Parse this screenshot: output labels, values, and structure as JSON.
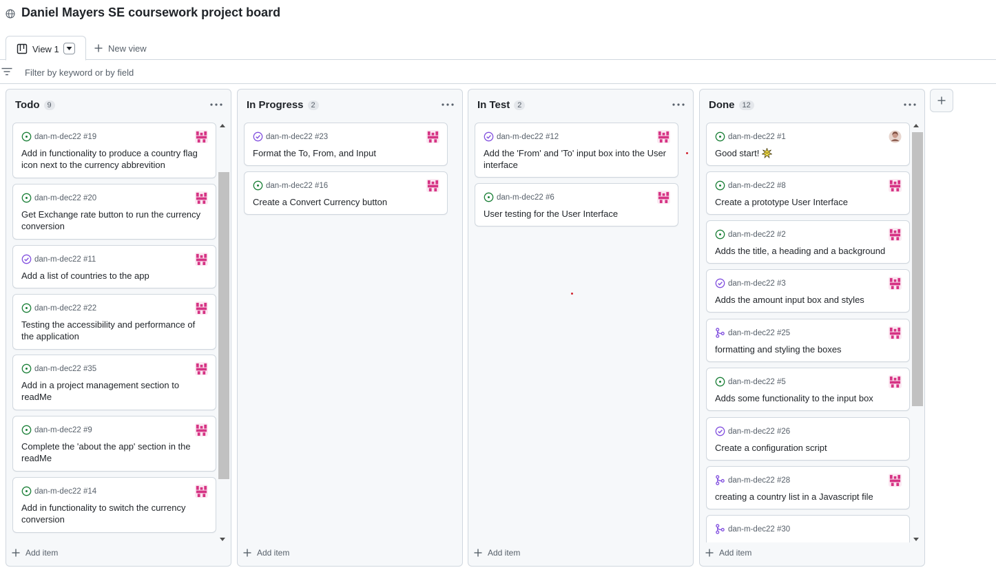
{
  "header": {
    "title": "Daniel Mayers SE coursework project board"
  },
  "tabs": {
    "active_label": "View 1",
    "new_view_label": "New view"
  },
  "filter": {
    "placeholder": "Filter by keyword or by field"
  },
  "colors": {
    "open": "#1a7f37",
    "done": "#8250df",
    "avatar": "#d63384"
  },
  "columns": [
    {
      "name": "Todo",
      "count": "9",
      "cards": [
        {
          "status": "open",
          "ref": "dan-m-dec22 #19",
          "title": "Add in functionality to produce a country flag icon next to the currency abbrevition",
          "avatar": "pink"
        },
        {
          "status": "open",
          "ref": "dan-m-dec22 #20",
          "title": "Get Exchange rate button to run the currency conversion",
          "avatar": "pink"
        },
        {
          "status": "done",
          "ref": "dan-m-dec22 #11",
          "title": "Add a list of countries to the app",
          "avatar": "pink"
        },
        {
          "status": "open",
          "ref": "dan-m-dec22 #22",
          "title": "Testing the accessibility and performance of the application",
          "avatar": "pink"
        },
        {
          "status": "open",
          "ref": "dan-m-dec22 #35",
          "title": "Add in a project management section to readMe",
          "avatar": "pink"
        },
        {
          "status": "open",
          "ref": "dan-m-dec22 #9",
          "title": "Complete the 'about the app' section in the readMe",
          "avatar": "pink"
        },
        {
          "status": "open",
          "ref": "dan-m-dec22 #14",
          "title": "Add in functionality to switch the currency conversion",
          "avatar": "pink"
        }
      ],
      "add_item": "Add item"
    },
    {
      "name": "In Progress",
      "count": "2",
      "cards": [
        {
          "status": "done",
          "ref": "dan-m-dec22 #23",
          "title": "Format the To, From, and Input",
          "avatar": "pink"
        },
        {
          "status": "open",
          "ref": "dan-m-dec22 #16",
          "title": "Create a Convert Currency button",
          "avatar": "pink"
        }
      ],
      "add_item": "Add item"
    },
    {
      "name": "In Test",
      "count": "2",
      "cards": [
        {
          "status": "done",
          "ref": "dan-m-dec22 #12",
          "title": "Add the 'From' and 'To' input box into the User interface",
          "avatar": "pink"
        },
        {
          "status": "open",
          "ref": "dan-m-dec22 #6",
          "title": "User testing for the User Interface",
          "avatar": "pink"
        }
      ],
      "add_item": "Add item"
    },
    {
      "name": "Done",
      "count": "12",
      "cards": [
        {
          "status": "open",
          "ref": "dan-m-dec22 #1",
          "title": "Good start!",
          "avatar": "photo",
          "emoji": "burst-icon"
        },
        {
          "status": "open",
          "ref": "dan-m-dec22 #8",
          "title": "Create a prototype User Interface",
          "avatar": "pink"
        },
        {
          "status": "open",
          "ref": "dan-m-dec22 #2",
          "title": "Adds the title, a heading and a background",
          "avatar": "pink"
        },
        {
          "status": "done",
          "ref": "dan-m-dec22 #3",
          "title": "Adds the amount input box and styles",
          "avatar": "pink"
        },
        {
          "status": "pr",
          "ref": "dan-m-dec22 #25",
          "title": "formatting and styling the boxes",
          "avatar": "pink"
        },
        {
          "status": "open",
          "ref": "dan-m-dec22 #5",
          "title": "Adds some functionality to the input box",
          "avatar": "pink"
        },
        {
          "status": "done",
          "ref": "dan-m-dec22 #26",
          "title": "Create a configuration script",
          "avatar": "none"
        },
        {
          "status": "pr",
          "ref": "dan-m-dec22 #28",
          "title": "creating a country list in a Javascript file",
          "avatar": "pink"
        },
        {
          "status": "pr",
          "ref": "dan-m-dec22 #30",
          "title": "",
          "avatar": "none"
        }
      ],
      "add_item": "Add item"
    }
  ]
}
